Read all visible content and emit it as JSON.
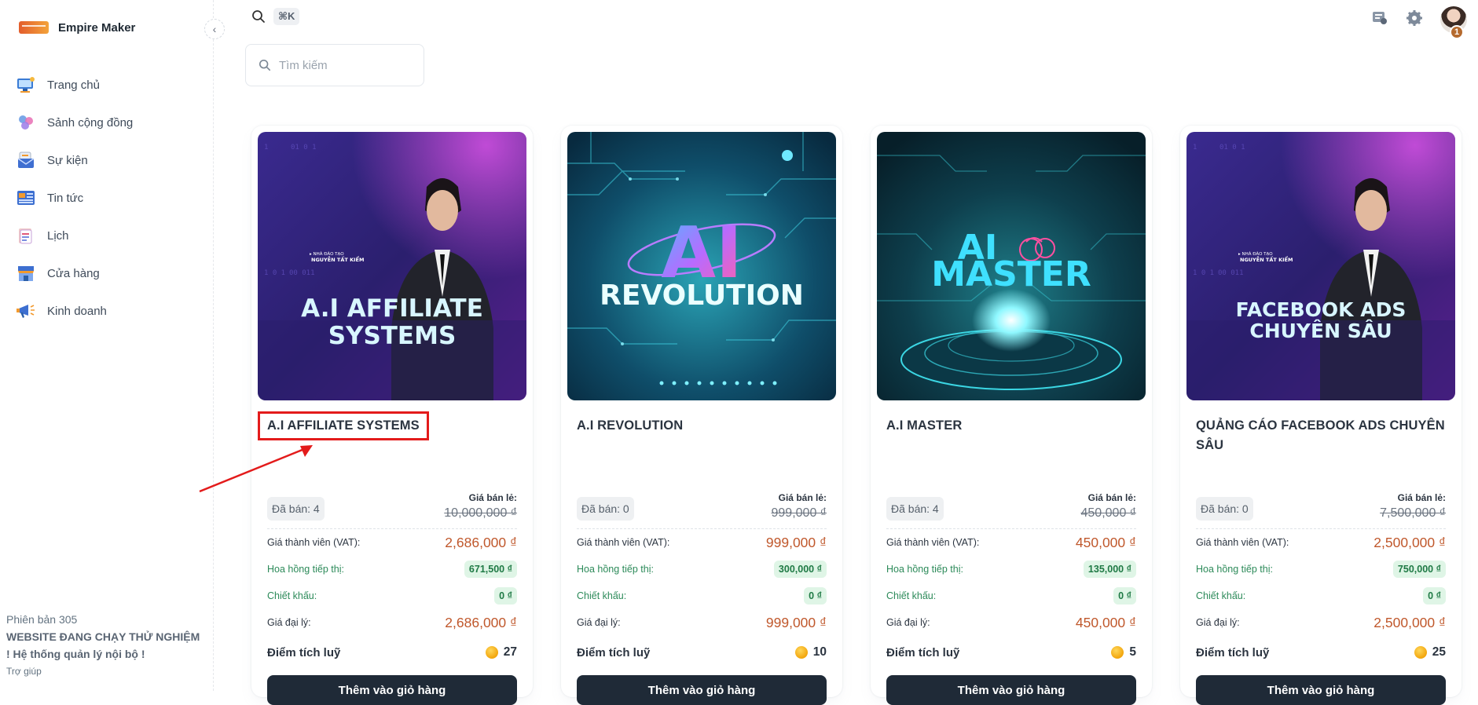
{
  "app": {
    "brand_name": "Empire Maker"
  },
  "sidebar": {
    "items": [
      {
        "label": "Trang chủ",
        "icon": "home-monitor-icon"
      },
      {
        "label": "Sảnh cộng đồng",
        "icon": "community-icon"
      },
      {
        "label": "Sự kiện",
        "icon": "event-mail-icon"
      },
      {
        "label": "Tin tức",
        "icon": "news-icon"
      },
      {
        "label": "Lịch",
        "icon": "calendar-icon"
      },
      {
        "label": "Cửa hàng",
        "icon": "store-icon"
      },
      {
        "label": "Kinh doanh",
        "icon": "megaphone-icon"
      }
    ],
    "version": "Phiên bản 305",
    "notice": "WEBSITE ĐANG CHẠY THỬ NGHIỆM ! Hệ thống quản lý nội bộ !",
    "help": "Trợ giúp"
  },
  "topbar": {
    "shortcut": "⌘K",
    "avatar_badge": "1"
  },
  "search": {
    "placeholder": "Tìm kiếm"
  },
  "labels": {
    "sold_prefix": "Đã bán:",
    "retail": "Giá bán lẻ:",
    "member": "Giá thành viên (VAT):",
    "commission": "Hoa hồng tiếp thị:",
    "discount": "Chiết khấu:",
    "agent": "Giá đại lý:",
    "points": "Điểm tích luỹ",
    "add_to_cart": "Thêm vào giỏ hàng"
  },
  "products": [
    {
      "title": "A.I AFFILIATE SYSTEMS",
      "image_text": [
        "A.I AFFILIATE",
        "SYSTEMS"
      ],
      "trainer_label": "▸ NHÀ ĐÀO TẠO",
      "trainer_name": "NGUYỄN TẤT KIỂM",
      "sold": "Đã bán: 4",
      "retail_price": "10,000,000 ₫",
      "member_price": "2,686,000 ₫",
      "commission": "671,500 ₫",
      "discount": "0 ₫",
      "agent_price": "2,686,000 ₫",
      "points": "27"
    },
    {
      "title": "A.I REVOLUTION",
      "image_text": [
        "AI",
        "REVOLUTION"
      ],
      "sold": "Đã bán: 0",
      "retail_price": "999,000 ₫",
      "member_price": "999,000 ₫",
      "commission": "300,000 ₫",
      "discount": "0 ₫",
      "agent_price": "999,000 ₫",
      "points": "10"
    },
    {
      "title": "A.I MASTER",
      "image_text": [
        "AI",
        "MASTER"
      ],
      "sold": "Đã bán: 4",
      "retail_price": "450,000 ₫",
      "member_price": "450,000 ₫",
      "commission": "135,000 ₫",
      "discount": "0 ₫",
      "agent_price": "450,000 ₫",
      "points": "5"
    },
    {
      "title": "QUẢNG CÁO FACEBOOK ADS CHUYÊN SÂU",
      "image_text": [
        "FACEBOOK ADS",
        "CHUYÊN SÂU"
      ],
      "trainer_label": "▸ NHÀ ĐÀO TẠO",
      "trainer_name": "NGUYỄN TẤT KIỂM",
      "sold": "Đã bán: 0",
      "retail_price": "7,500,000 ₫",
      "member_price": "2,500,000 ₫",
      "commission": "750,000 ₫",
      "discount": "0 ₫",
      "agent_price": "2,500,000 ₫",
      "points": "25"
    }
  ],
  "colors": {
    "accent_dark": "#1f2a37",
    "price_orange": "#c0582c",
    "commission_green": "#2c8a59",
    "highlight_red": "#e31b1b"
  }
}
